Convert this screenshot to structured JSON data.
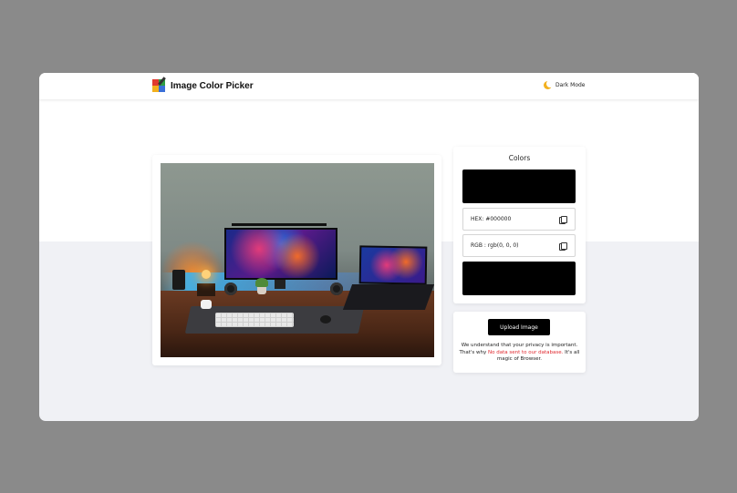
{
  "app": {
    "title": "Image Color Picker",
    "dark_mode_label": "Dark Mode"
  },
  "colors_panel": {
    "title": "Colors",
    "swatch_color": "#000000",
    "hex_text": "HEX: #000000",
    "rgb_text": "RGB : rgb(0, 0, 0)"
  },
  "upload_panel": {
    "button_label": "Upload Image",
    "privacy_prefix": "We understand that your privacy is important. That's why ",
    "privacy_highlight": "No data sent to our database.",
    "privacy_suffix": " It's all magic of Browser."
  },
  "colors": {
    "accent_red": "#e0282e",
    "button_bg": "#000000",
    "page_bg": "#f0f1f5"
  },
  "icons": {
    "logo": "color-picker-logo-icon",
    "dark_mode": "moon-icon",
    "copy": "copy-icon"
  }
}
